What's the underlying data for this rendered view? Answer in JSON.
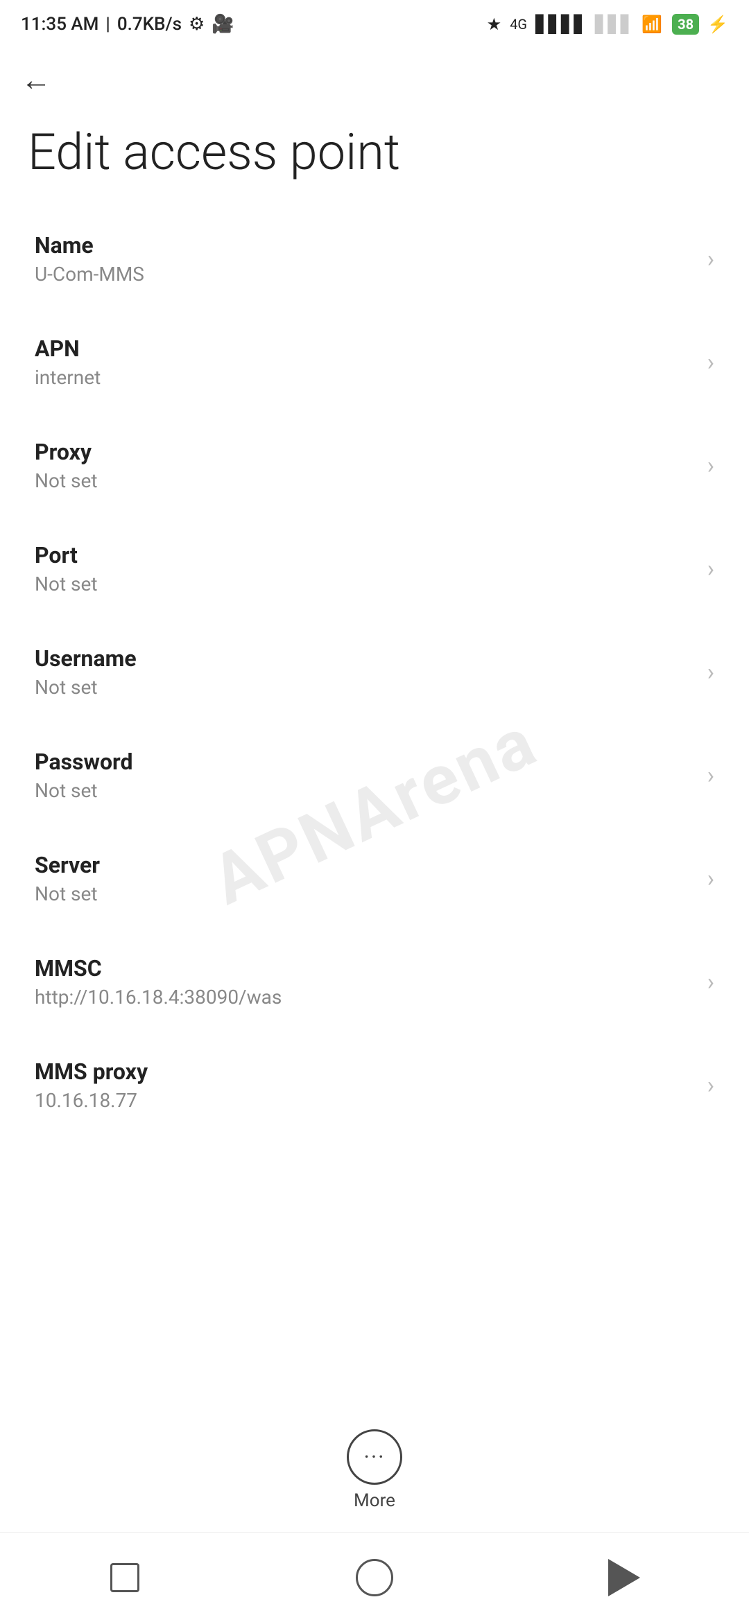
{
  "statusBar": {
    "time": "11:35 AM",
    "speed": "0.7KB/s"
  },
  "nav": {
    "backLabel": "←"
  },
  "pageTitle": "Edit access point",
  "watermark": "APNArena",
  "settingsItems": [
    {
      "id": "name",
      "label": "Name",
      "value": "U-Com-MMS"
    },
    {
      "id": "apn",
      "label": "APN",
      "value": "internet"
    },
    {
      "id": "proxy",
      "label": "Proxy",
      "value": "Not set"
    },
    {
      "id": "port",
      "label": "Port",
      "value": "Not set"
    },
    {
      "id": "username",
      "label": "Username",
      "value": "Not set"
    },
    {
      "id": "password",
      "label": "Password",
      "value": "Not set"
    },
    {
      "id": "server",
      "label": "Server",
      "value": "Not set"
    },
    {
      "id": "mmsc",
      "label": "MMSC",
      "value": "http://10.16.18.4:38090/was"
    },
    {
      "id": "mms-proxy",
      "label": "MMS proxy",
      "value": "10.16.18.77"
    }
  ],
  "moreButton": {
    "label": "More",
    "icon": "···"
  },
  "bottomNav": {
    "square": "square-button",
    "circle": "home-button",
    "triangle": "back-button"
  }
}
